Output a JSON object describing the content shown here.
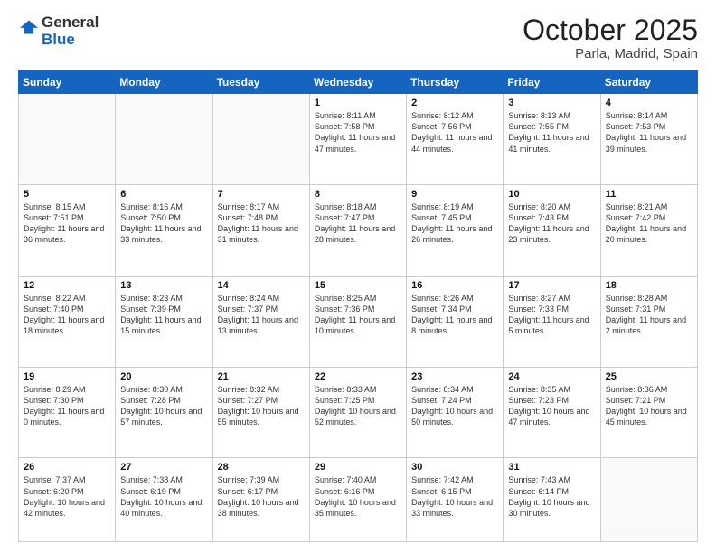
{
  "logo": {
    "general": "General",
    "blue": "Blue"
  },
  "header": {
    "month": "October 2025",
    "location": "Parla, Madrid, Spain"
  },
  "weekdays": [
    "Sunday",
    "Monday",
    "Tuesday",
    "Wednesday",
    "Thursday",
    "Friday",
    "Saturday"
  ],
  "days": [
    {
      "num": "",
      "empty": true
    },
    {
      "num": "",
      "empty": true
    },
    {
      "num": "",
      "empty": true
    },
    {
      "num": "1",
      "sunrise": "8:11 AM",
      "sunset": "7:58 PM",
      "daylight": "11 hours and 47 minutes."
    },
    {
      "num": "2",
      "sunrise": "8:12 AM",
      "sunset": "7:56 PM",
      "daylight": "11 hours and 44 minutes."
    },
    {
      "num": "3",
      "sunrise": "8:13 AM",
      "sunset": "7:55 PM",
      "daylight": "11 hours and 41 minutes."
    },
    {
      "num": "4",
      "sunrise": "8:14 AM",
      "sunset": "7:53 PM",
      "daylight": "11 hours and 39 minutes."
    },
    {
      "num": "5",
      "sunrise": "8:15 AM",
      "sunset": "7:51 PM",
      "daylight": "11 hours and 36 minutes."
    },
    {
      "num": "6",
      "sunrise": "8:16 AM",
      "sunset": "7:50 PM",
      "daylight": "11 hours and 33 minutes."
    },
    {
      "num": "7",
      "sunrise": "8:17 AM",
      "sunset": "7:48 PM",
      "daylight": "11 hours and 31 minutes."
    },
    {
      "num": "8",
      "sunrise": "8:18 AM",
      "sunset": "7:47 PM",
      "daylight": "11 hours and 28 minutes."
    },
    {
      "num": "9",
      "sunrise": "8:19 AM",
      "sunset": "7:45 PM",
      "daylight": "11 hours and 26 minutes."
    },
    {
      "num": "10",
      "sunrise": "8:20 AM",
      "sunset": "7:43 PM",
      "daylight": "11 hours and 23 minutes."
    },
    {
      "num": "11",
      "sunrise": "8:21 AM",
      "sunset": "7:42 PM",
      "daylight": "11 hours and 20 minutes."
    },
    {
      "num": "12",
      "sunrise": "8:22 AM",
      "sunset": "7:40 PM",
      "daylight": "11 hours and 18 minutes."
    },
    {
      "num": "13",
      "sunrise": "8:23 AM",
      "sunset": "7:39 PM",
      "daylight": "11 hours and 15 minutes."
    },
    {
      "num": "14",
      "sunrise": "8:24 AM",
      "sunset": "7:37 PM",
      "daylight": "11 hours and 13 minutes."
    },
    {
      "num": "15",
      "sunrise": "8:25 AM",
      "sunset": "7:36 PM",
      "daylight": "11 hours and 10 minutes."
    },
    {
      "num": "16",
      "sunrise": "8:26 AM",
      "sunset": "7:34 PM",
      "daylight": "11 hours and 8 minutes."
    },
    {
      "num": "17",
      "sunrise": "8:27 AM",
      "sunset": "7:33 PM",
      "daylight": "11 hours and 5 minutes."
    },
    {
      "num": "18",
      "sunrise": "8:28 AM",
      "sunset": "7:31 PM",
      "daylight": "11 hours and 2 minutes."
    },
    {
      "num": "19",
      "sunrise": "8:29 AM",
      "sunset": "7:30 PM",
      "daylight": "11 hours and 0 minutes."
    },
    {
      "num": "20",
      "sunrise": "8:30 AM",
      "sunset": "7:28 PM",
      "daylight": "10 hours and 57 minutes."
    },
    {
      "num": "21",
      "sunrise": "8:32 AM",
      "sunset": "7:27 PM",
      "daylight": "10 hours and 55 minutes."
    },
    {
      "num": "22",
      "sunrise": "8:33 AM",
      "sunset": "7:25 PM",
      "daylight": "10 hours and 52 minutes."
    },
    {
      "num": "23",
      "sunrise": "8:34 AM",
      "sunset": "7:24 PM",
      "daylight": "10 hours and 50 minutes."
    },
    {
      "num": "24",
      "sunrise": "8:35 AM",
      "sunset": "7:23 PM",
      "daylight": "10 hours and 47 minutes."
    },
    {
      "num": "25",
      "sunrise": "8:36 AM",
      "sunset": "7:21 PM",
      "daylight": "10 hours and 45 minutes."
    },
    {
      "num": "26",
      "sunrise": "7:37 AM",
      "sunset": "6:20 PM",
      "daylight": "10 hours and 42 minutes."
    },
    {
      "num": "27",
      "sunrise": "7:38 AM",
      "sunset": "6:19 PM",
      "daylight": "10 hours and 40 minutes."
    },
    {
      "num": "28",
      "sunrise": "7:39 AM",
      "sunset": "6:17 PM",
      "daylight": "10 hours and 38 minutes."
    },
    {
      "num": "29",
      "sunrise": "7:40 AM",
      "sunset": "6:16 PM",
      "daylight": "10 hours and 35 minutes."
    },
    {
      "num": "30",
      "sunrise": "7:42 AM",
      "sunset": "6:15 PM",
      "daylight": "10 hours and 33 minutes."
    },
    {
      "num": "31",
      "sunrise": "7:43 AM",
      "sunset": "6:14 PM",
      "daylight": "10 hours and 30 minutes."
    },
    {
      "num": "",
      "empty": true
    }
  ],
  "labels": {
    "sunrise_prefix": "Sunrise: ",
    "sunset_prefix": "Sunset: ",
    "daylight_prefix": "Daylight: "
  }
}
